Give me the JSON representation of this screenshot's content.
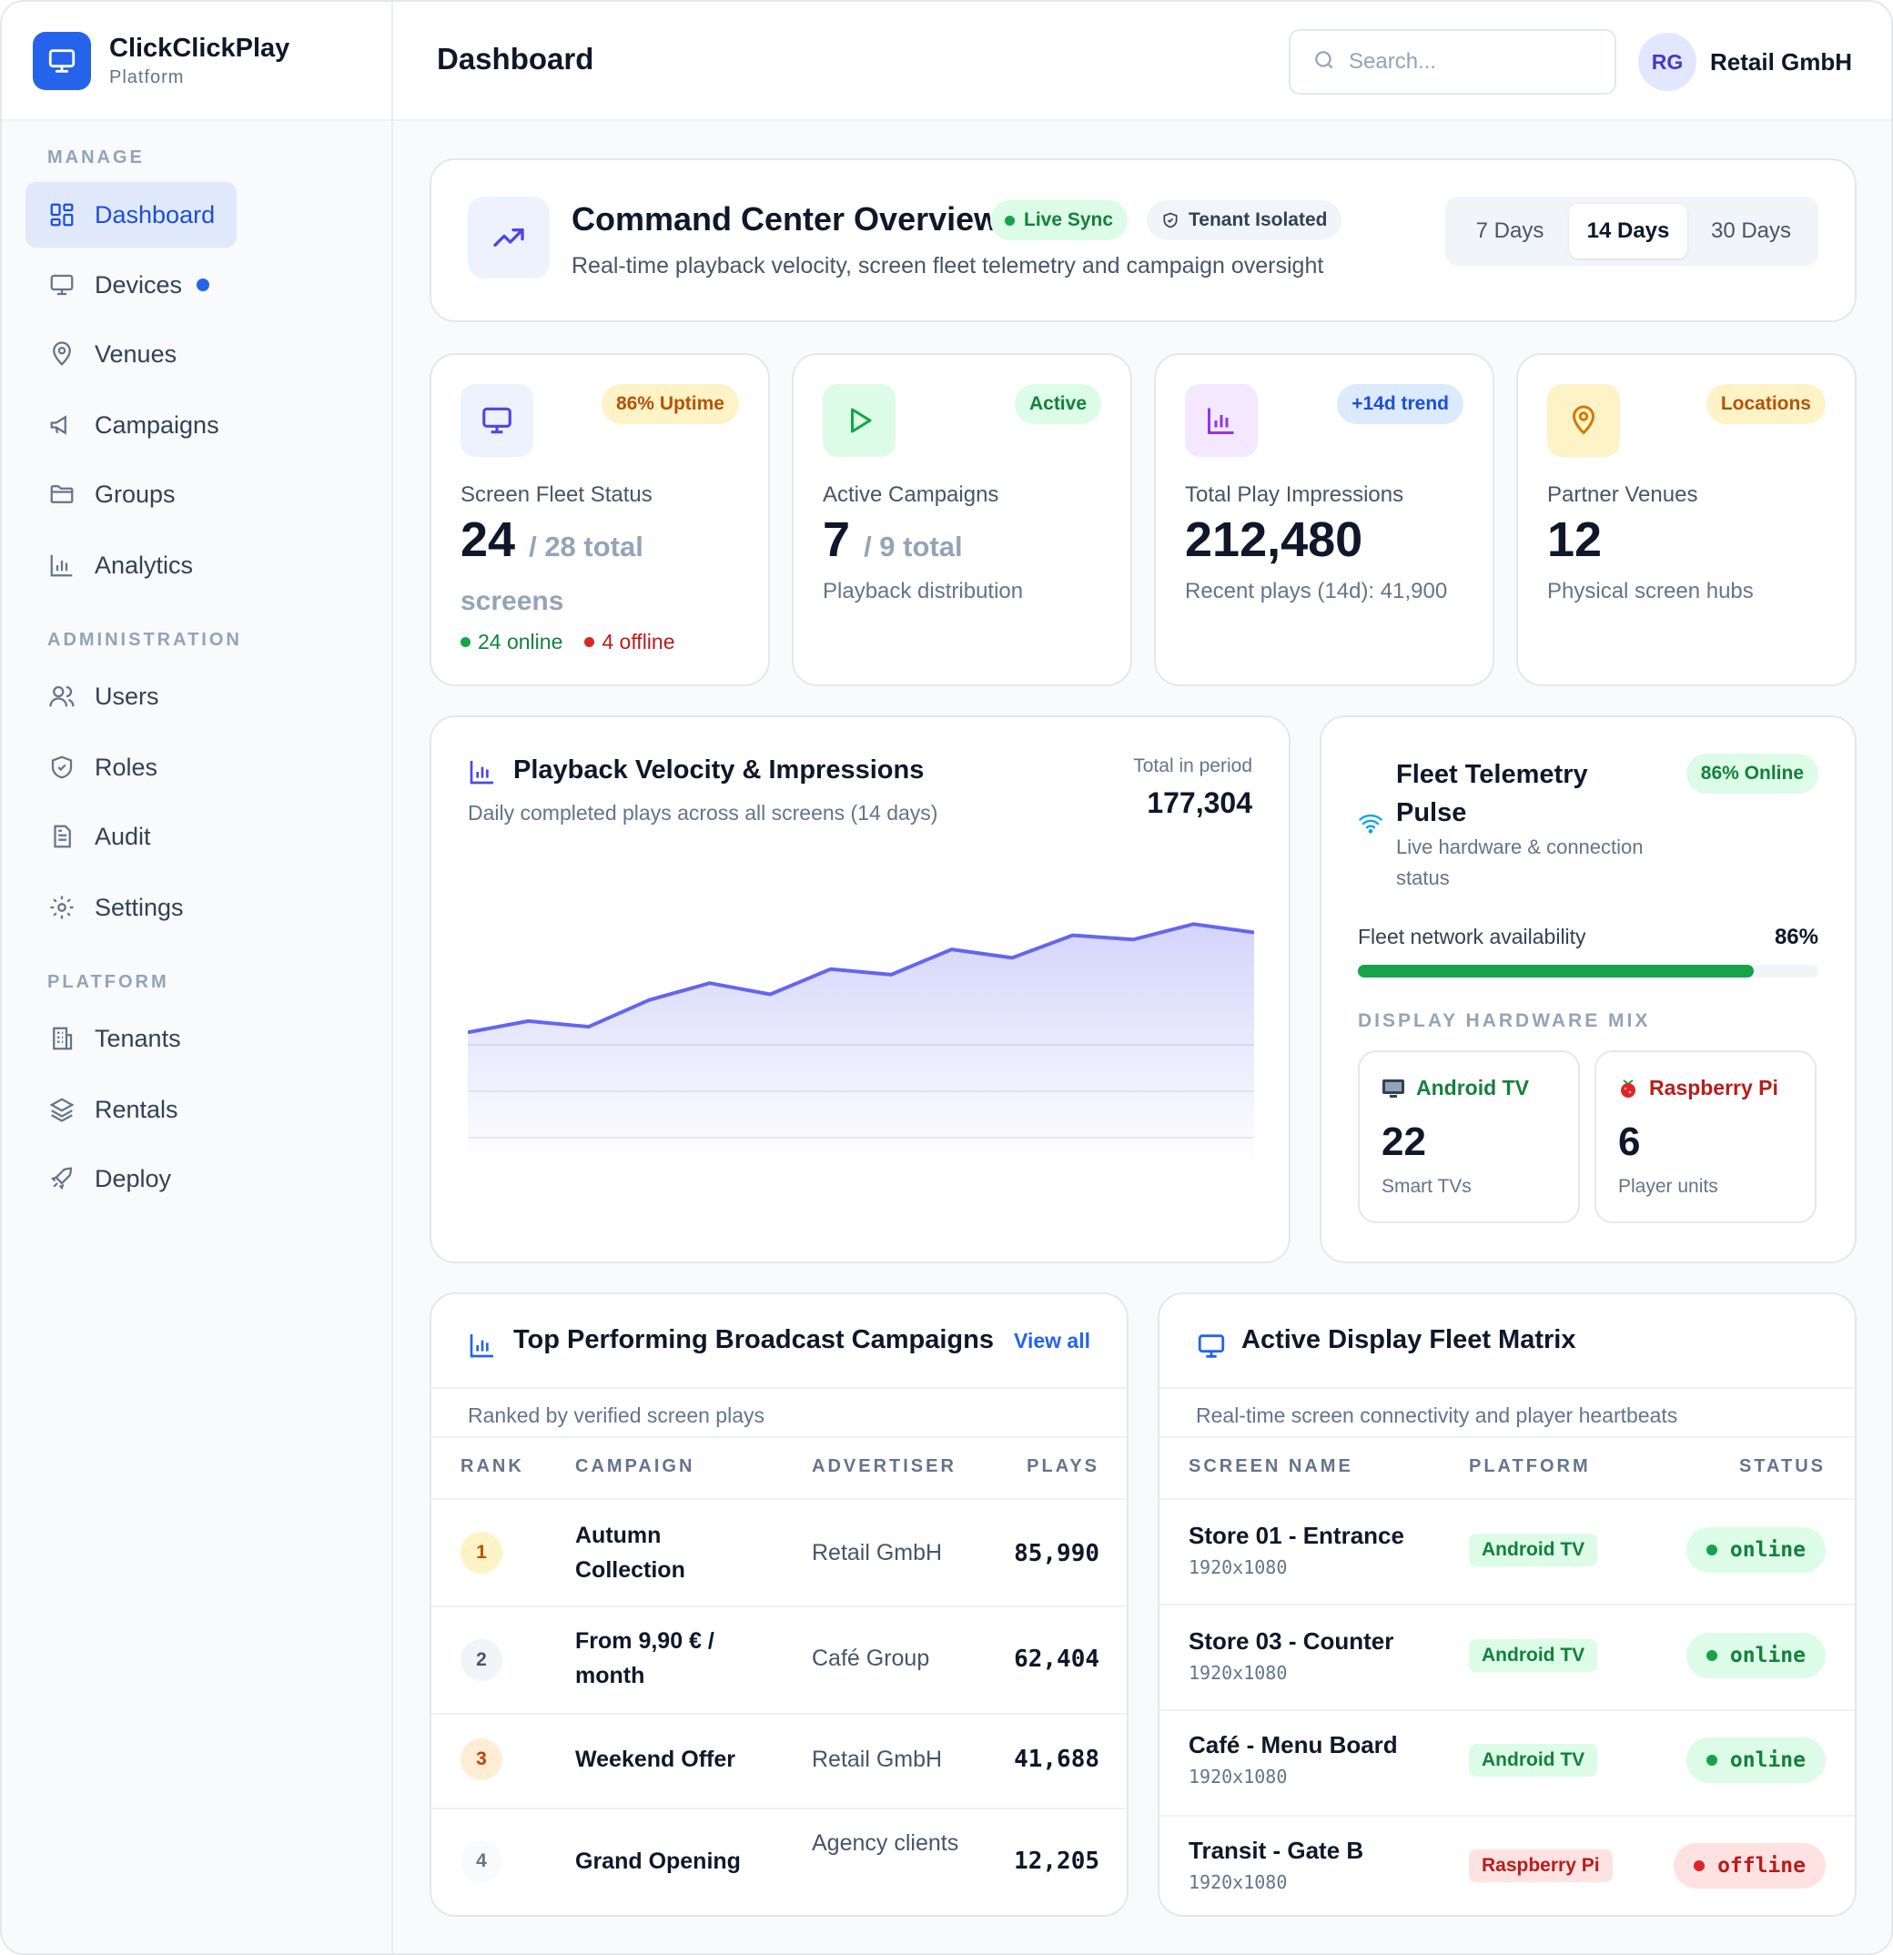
{
  "brand": {
    "name": "ClickClickPlay",
    "sub": "Platform"
  },
  "nav": {
    "manage_label": "MANAGE",
    "admin_label": "ADMINISTRATION",
    "platform_label": "PLATFORM",
    "items": [
      {
        "label": "Dashboard",
        "icon": "dashboard-icon"
      },
      {
        "label": "Devices",
        "icon": "monitor-icon"
      },
      {
        "label": "Venues",
        "icon": "map-pin-icon"
      },
      {
        "label": "Campaigns",
        "icon": "megaphone-icon"
      },
      {
        "label": "Groups",
        "icon": "folder-icon"
      },
      {
        "label": "Analytics",
        "icon": "bar-chart-icon"
      },
      {
        "label": "Users",
        "icon": "users-icon"
      },
      {
        "label": "Roles",
        "icon": "shield-icon"
      },
      {
        "label": "Audit",
        "icon": "document-icon"
      },
      {
        "label": "Settings",
        "icon": "gear-icon"
      },
      {
        "label": "Tenants",
        "icon": "building-icon"
      },
      {
        "label": "Rentals",
        "icon": "layers-icon"
      },
      {
        "label": "Deploy",
        "icon": "rocket-icon"
      }
    ]
  },
  "header": {
    "title": "Dashboard",
    "search_placeholder": "Search...",
    "avatar_initials": "RG",
    "tenant": "Retail GmbH"
  },
  "overview": {
    "title": "Command Center Overview",
    "badge_live": "Live Sync",
    "badge_tenant": "Tenant Isolated",
    "subtitle": "Real-time playback velocity, screen fleet telemetry and campaign oversight",
    "ranges": [
      "7 Days",
      "14 Days",
      "30 Days"
    ],
    "selected_range": "14 Days"
  },
  "stats": {
    "fleet": {
      "badge": "86% Uptime",
      "label": "Screen Fleet Status",
      "value": "24",
      "of": "/ 28 total",
      "unit": "screens",
      "online": "24 online",
      "offline": "4 offline"
    },
    "campaigns": {
      "badge": "Active",
      "label": "Active Campaigns",
      "value": "7",
      "of": "/ 9 total",
      "sub": "Playback distribution"
    },
    "impressions": {
      "badge": "+14d trend",
      "label": "Total Play Impressions",
      "value": "212,480",
      "sub": "Recent plays (14d): 41,900"
    },
    "venues": {
      "badge": "Locations",
      "label": "Partner Venues",
      "value": "12",
      "sub": "Physical screen hubs"
    }
  },
  "velocity": {
    "title": "Playback Velocity & Impressions",
    "subtitle": "Daily completed plays across all screens (14 days)",
    "total_label": "Total in period",
    "total": "177,304"
  },
  "chart_data": {
    "type": "area",
    "x": [
      1,
      2,
      3,
      4,
      5,
      6,
      7,
      8,
      9,
      10,
      11,
      12,
      13,
      14
    ],
    "values": [
      9300,
      10100,
      9700,
      11600,
      12800,
      12000,
      13800,
      13400,
      15200,
      14600,
      16200,
      15900,
      17000,
      16400
    ],
    "ylim": [
      0,
      22000
    ],
    "grid": true,
    "color": "#6366f1"
  },
  "telemetry": {
    "title": "Fleet Telemetry Pulse",
    "badge": "86% Online",
    "subtitle": "Live hardware & connection status",
    "availability_label": "Fleet network availability",
    "availability_value": "86%",
    "availability_fraction": 0.86,
    "mix_label": "DISPLAY HARDWARE MIX",
    "android": {
      "name": "Android TV",
      "count": "22",
      "sub": "Smart TVs"
    },
    "raspberry": {
      "name": "Raspberry Pi",
      "count": "6",
      "sub": "Player units"
    }
  },
  "campaigns_table": {
    "title": "Top Performing Broadcast Campaigns",
    "view_all": "View all",
    "subtitle": "Ranked by verified screen plays",
    "headers": [
      "RANK",
      "CAMPAIGN",
      "ADVERTISER",
      "PLAYS"
    ],
    "rows": [
      {
        "rank": "1",
        "campaign": "Autumn Collection",
        "advertiser": "Retail GmbH",
        "plays": "85,990"
      },
      {
        "rank": "2",
        "campaign": "From 9,90 € / month",
        "advertiser": "Café Group",
        "plays": "62,404"
      },
      {
        "rank": "3",
        "campaign": "Weekend Offer",
        "advertiser": "Retail GmbH",
        "plays": "41,688"
      },
      {
        "rank": "4",
        "campaign": "Grand Opening",
        "advertiser": "Agency clients",
        "plays": "12,205"
      }
    ]
  },
  "fleet_table": {
    "title": "Active Display Fleet Matrix",
    "subtitle": "Real-time screen connectivity and player heartbeats",
    "headers": [
      "SCREEN NAME",
      "PLATFORM",
      "STATUS"
    ],
    "rows": [
      {
        "name": "Store 01 - Entrance",
        "res": "1920x1080",
        "platform": "Android TV",
        "status": "online"
      },
      {
        "name": "Store 03 - Counter",
        "res": "1920x1080",
        "platform": "Android TV",
        "status": "online"
      },
      {
        "name": "Café - Menu Board",
        "res": "1920x1080",
        "platform": "Android TV",
        "status": "online"
      },
      {
        "name": "Transit - Gate B",
        "res": "1920x1080",
        "platform": "Raspberry Pi",
        "status": "offline"
      }
    ]
  },
  "colors": {
    "accent": "#2563eb",
    "chart": "#6366f1",
    "online": "#16a34a",
    "offline": "#dc2626"
  }
}
